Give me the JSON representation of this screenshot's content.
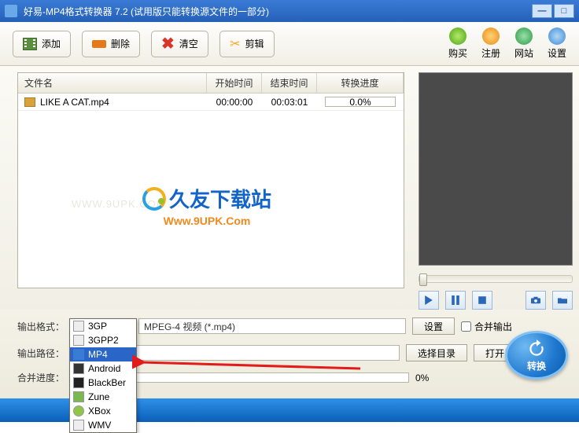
{
  "title": "好易-MP4格式转换器 7.2 (试用版只能转换源文件的一部分)",
  "toolbar": {
    "add": "添加",
    "delete": "删除",
    "clear": "清空",
    "edit": "剪辑"
  },
  "rightmenu": {
    "buy": "购买",
    "register": "注册",
    "website": "网站",
    "settings": "设置"
  },
  "columns": {
    "name": "文件名",
    "start": "开始时间",
    "end": "结束时间",
    "progress": "转换进度"
  },
  "rows": [
    {
      "name": "LIKE A CAT.mp4",
      "start": "00:00:00",
      "end": "00:03:01",
      "progress": "0.0%"
    }
  ],
  "watermark": {
    "faint": "WWW.9UPK.COM",
    "cn": "久友下载站",
    "url": "Www.9UPK.Com"
  },
  "output": {
    "format_label": "输出格式：",
    "selected": "MP4",
    "desc": "MPEG-4 视频 (*.mp4)",
    "settings_btn": "设置",
    "merge": "合并输出",
    "path_label": "输出路径：",
    "choose": "选择目录",
    "open": "打开目录",
    "merge_progress_label": "合并进度：",
    "merge_progress_value": "0%"
  },
  "convert": "转换",
  "dropdown": [
    "3GP",
    "3GPP2",
    "MP4",
    "Android",
    "BlackBer",
    "Zune",
    "XBox",
    "WMV"
  ]
}
